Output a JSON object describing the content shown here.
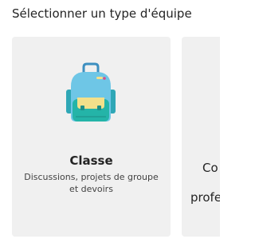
{
  "page": {
    "title": "Sélectionner un type d'équipe"
  },
  "cards": [
    {
      "icon": "backpack-icon",
      "title": "Classe",
      "description": "Discussions, projets de groupe et devoirs"
    },
    {
      "title_partial": "Co",
      "description_partial": "profe"
    }
  ],
  "colors": {
    "card_background": "#f0f0f0",
    "backpack_body": "#6ec6e6",
    "backpack_pocket": "#24b4a8",
    "backpack_flap": "#f3e08a"
  }
}
